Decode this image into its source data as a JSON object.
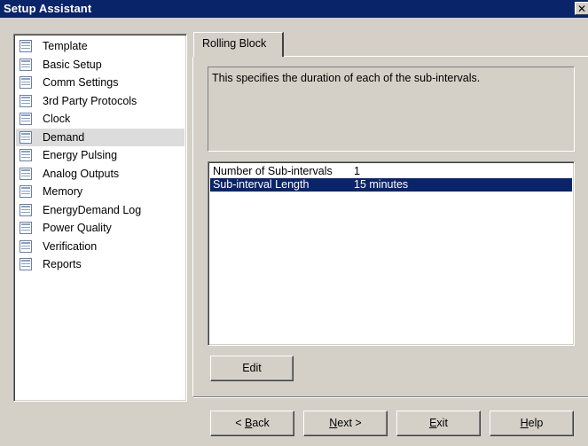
{
  "window": {
    "title": "Setup Assistant",
    "close_label": "✕"
  },
  "nav": {
    "items": [
      {
        "label": "Template"
      },
      {
        "label": "Basic Setup"
      },
      {
        "label": "Comm Settings"
      },
      {
        "label": "3rd Party Protocols"
      },
      {
        "label": "Clock"
      },
      {
        "label": "Demand",
        "selected": true
      },
      {
        "label": "Energy Pulsing"
      },
      {
        "label": "Analog Outputs"
      },
      {
        "label": "Memory"
      },
      {
        "label": "EnergyDemand Log"
      },
      {
        "label": "Power Quality"
      },
      {
        "label": "Verification"
      },
      {
        "label": "Reports"
      }
    ]
  },
  "tab": {
    "label": "Rolling Block"
  },
  "description": "This specifies the duration of each of the sub-intervals.",
  "settings": {
    "rows": [
      {
        "name": "Number of Sub-intervals",
        "value": "1",
        "selected": false
      },
      {
        "name": "Sub-interval Length",
        "value": "15 minutes",
        "selected": true
      }
    ]
  },
  "buttons": {
    "edit": "Edit",
    "back": {
      "prefix": "< ",
      "mnemonic": "B",
      "rest": "ack"
    },
    "next": {
      "mnemonic": "N",
      "rest": "ext >"
    },
    "exit": {
      "mnemonic": "E",
      "rest": "xit"
    },
    "help": {
      "mnemonic": "H",
      "rest": "elp"
    }
  }
}
